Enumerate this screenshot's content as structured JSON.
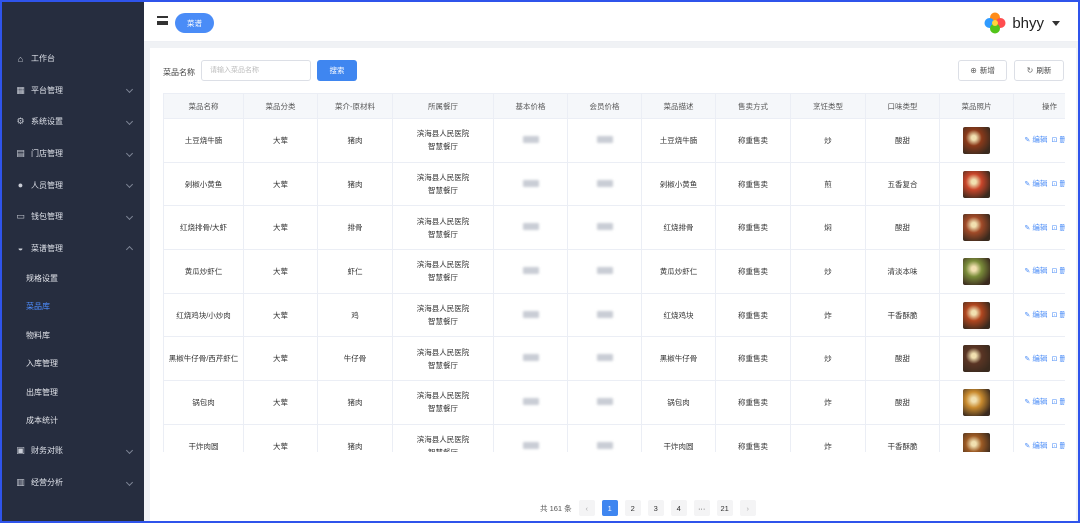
{
  "topbar": {
    "menu_pill": "菜谱",
    "brand_name": "bhyy"
  },
  "sidebar": {
    "items": [
      {
        "label": "工作台",
        "icon": "home-icon",
        "expandable": false
      },
      {
        "label": "平台管理",
        "icon": "grid-icon",
        "expandable": true
      },
      {
        "label": "系统设置",
        "icon": "gear-icon",
        "expandable": true
      },
      {
        "label": "门店管理",
        "icon": "store-icon",
        "expandable": true
      },
      {
        "label": "人员管理",
        "icon": "user-icon",
        "expandable": true
      },
      {
        "label": "钱包管理",
        "icon": "wallet-icon",
        "expandable": true
      },
      {
        "label": "菜谱管理",
        "icon": "dish-icon",
        "expandable": true,
        "expanded": true
      }
    ],
    "subitems": [
      {
        "label": "规格设置",
        "active": false
      },
      {
        "label": "菜品库",
        "active": true
      },
      {
        "label": "物料库",
        "active": false
      },
      {
        "label": "入库管理",
        "active": false
      },
      {
        "label": "出库管理",
        "active": false
      },
      {
        "label": "成本统计",
        "active": false
      }
    ],
    "tail_items": [
      {
        "label": "财务对账",
        "icon": "ledger-icon",
        "expandable": true
      },
      {
        "label": "经营分析",
        "icon": "chart-icon",
        "expandable": true
      }
    ]
  },
  "search": {
    "label": "菜品名称",
    "placeholder": "请输入菜品名称",
    "button": "搜索"
  },
  "toolbar": {
    "add_label": "新增",
    "refresh_label": "刷新"
  },
  "table": {
    "columns": [
      "菜品名称",
      "菜品分类",
      "菜介-原材料",
      "所属餐厅",
      "基本价格",
      "会员价格",
      "菜品描述",
      "售卖方式",
      "烹饪类型",
      "口味类型",
      "菜品照片",
      "操作"
    ],
    "edit_label": "编辑",
    "delete_label": "删除",
    "rows": [
      {
        "name": "土豆烧牛腩",
        "category": "大荤",
        "material": "猪肉",
        "restaurant_line1": "滨海县人民医院",
        "restaurant_line2": "智慧餐厅",
        "desc": "土豆烧牛腩",
        "sale": "称重售卖",
        "cook": "炒",
        "taste": "酸甜",
        "photo_color": "#8b3a1a"
      },
      {
        "name": "剁椒小黄鱼",
        "category": "大荤",
        "material": "猪肉",
        "restaurant_line1": "滨海县人民医院",
        "restaurant_line2": "智慧餐厅",
        "desc": "剁椒小黄鱼",
        "sale": "称重售卖",
        "cook": "煎",
        "taste": "五香复合",
        "photo_color": "#c8452a"
      },
      {
        "name": "红烧排骨/大虾",
        "category": "大荤",
        "material": "排骨",
        "restaurant_line1": "滨海县人民医院",
        "restaurant_line2": "智慧餐厅",
        "desc": "红烧排骨",
        "sale": "称重售卖",
        "cook": "焖",
        "taste": "酸甜",
        "photo_color": "#a04a28"
      },
      {
        "name": "黄瓜炒虾仁",
        "category": "大荤",
        "material": "虾仁",
        "restaurant_line1": "滨海县人民医院",
        "restaurant_line2": "智慧餐厅",
        "desc": "黄瓜炒虾仁",
        "sale": "称重售卖",
        "cook": "炒",
        "taste": "清淡本味",
        "photo_color": "#7a8c3a"
      },
      {
        "name": "红烧鸡块/小炒肉",
        "category": "大荤",
        "material": "鸡",
        "restaurant_line1": "滨海县人民医院",
        "restaurant_line2": "智慧餐厅",
        "desc": "红烧鸡块",
        "sale": "称重售卖",
        "cook": "炸",
        "taste": "干香酥脆",
        "photo_color": "#b0461f"
      },
      {
        "name": "黑椒牛仔骨/西芹虾仁",
        "category": "大荤",
        "material": "牛仔骨",
        "restaurant_line1": "滨海县人民医院",
        "restaurant_line2": "智慧餐厅",
        "desc": "黑椒牛仔骨",
        "sale": "称重售卖",
        "cook": "炒",
        "taste": "酸甜",
        "photo_color": "#5a3524"
      },
      {
        "name": "锅包肉",
        "category": "大荤",
        "material": "猪肉",
        "restaurant_line1": "滨海县人民医院",
        "restaurant_line2": "智慧餐厅",
        "desc": "锅包肉",
        "sale": "称重售卖",
        "cook": "炸",
        "taste": "酸甜",
        "photo_color": "#c88a2e"
      },
      {
        "name": "干炸肉圆",
        "category": "大荤",
        "material": "猪肉",
        "restaurant_line1": "滨海县人民医院",
        "restaurant_line2": "智慧餐厅",
        "desc": "干炸肉圆",
        "sale": "称重售卖",
        "cook": "炸",
        "taste": "干香酥脆",
        "photo_color": "#9c5a24"
      }
    ]
  },
  "pagination": {
    "total_text": "共 161 条",
    "pages": [
      "1",
      "2",
      "3",
      "4",
      "···",
      "21"
    ],
    "current": "1"
  },
  "colors": {
    "sidebar_bg": "#262d3f",
    "accent": "#3f86f0",
    "active_sub": "#4d8dff"
  }
}
